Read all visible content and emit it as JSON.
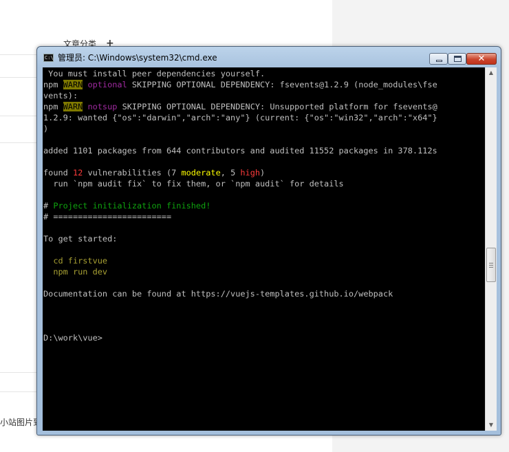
{
  "background": {
    "category_label": "文章分类",
    "category_action": "+",
    "bottom_text": "小站图片到"
  },
  "window": {
    "title": "管理员: C:\\Windows\\system32\\cmd.exe",
    "icon_text": "C:\\",
    "close_glyph": "✕"
  },
  "console_lines": [
    [
      {
        "t": " You must install peer dependencies yourself."
      }
    ],
    [
      {
        "t": "npm "
      },
      {
        "t": "WARN",
        "c": "warn"
      },
      {
        "t": " "
      },
      {
        "t": "optional",
        "c": "purple"
      },
      {
        "t": " SKIPPING OPTIONAL DEPENDENCY: fsevents@1.2.9 (node_modules\\fse"
      }
    ],
    [
      {
        "t": "vents):"
      }
    ],
    [
      {
        "t": "npm "
      },
      {
        "t": "WARN",
        "c": "warn"
      },
      {
        "t": " "
      },
      {
        "t": "notsup",
        "c": "purple"
      },
      {
        "t": " SKIPPING OPTIONAL DEPENDENCY: Unsupported platform for fsevents@"
      }
    ],
    [
      {
        "t": "1.2.9: wanted {\"os\":\"darwin\",\"arch\":\"any\"} (current: {\"os\":\"win32\",\"arch\":\"x64\"}"
      }
    ],
    [
      {
        "t": ")"
      }
    ],
    [
      {
        "t": ""
      }
    ],
    [
      {
        "t": "added 1101 packages from 644 contributors and audited 11552 packages in 378.112s"
      }
    ],
    [
      {
        "t": ""
      }
    ],
    [
      {
        "t": "found "
      },
      {
        "t": "12",
        "c": "red"
      },
      {
        "t": " vulnerabilities (7 "
      },
      {
        "t": "moderate",
        "c": "yellow"
      },
      {
        "t": ", 5 "
      },
      {
        "t": "high",
        "c": "red"
      },
      {
        "t": ")"
      }
    ],
    [
      {
        "t": "  run `npm audit fix` to fix them, or `npm audit` for details"
      }
    ],
    [
      {
        "t": ""
      }
    ],
    [
      {
        "t": "# "
      },
      {
        "t": "Project initialization finished!",
        "c": "green"
      }
    ],
    [
      {
        "t": "# ========================"
      }
    ],
    [
      {
        "t": ""
      }
    ],
    [
      {
        "t": "To get started:"
      }
    ],
    [
      {
        "t": ""
      }
    ],
    [
      {
        "t": "  cd firstvue",
        "c": "olive"
      }
    ],
    [
      {
        "t": "  npm run dev",
        "c": "olive"
      }
    ],
    [
      {
        "t": ""
      }
    ],
    [
      {
        "t": "Documentation can be found at https://vuejs-templates.github.io/webpack"
      }
    ],
    [
      {
        "t": ""
      }
    ],
    [
      {
        "t": ""
      }
    ],
    [
      {
        "t": ""
      }
    ],
    [
      {
        "t": "D:\\work\\vue>"
      }
    ]
  ],
  "scrollbar": {
    "up_glyph": "▲",
    "down_glyph": "▼"
  }
}
